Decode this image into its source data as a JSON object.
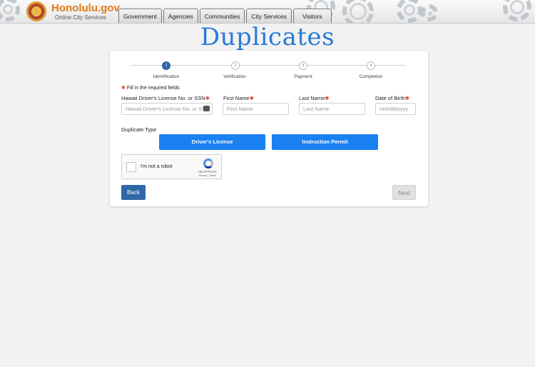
{
  "header": {
    "site_name": "Honolulu.gov",
    "site_subtitle": "Online City Services",
    "nav": [
      "Government",
      "Agencies",
      "Communities",
      "City Services",
      "Visitors"
    ]
  },
  "page_title": "Duplicates",
  "steps": [
    {
      "num": "1",
      "label": "Identification",
      "active": true
    },
    {
      "num": "2",
      "label": "Verification",
      "active": false
    },
    {
      "num": "3",
      "label": "Payment",
      "active": false
    },
    {
      "num": "4",
      "label": "Completion",
      "active": false
    }
  ],
  "form": {
    "required_note": "Fill in the required fields",
    "license": {
      "label": "Hawaii Driver's License No. or SSN",
      "placeholder": "Hawaii Driver's License No. or SSN"
    },
    "first_name": {
      "label": "First Name",
      "placeholder": "First Name"
    },
    "last_name": {
      "label": "Last Name",
      "placeholder": "Last Name"
    },
    "dob": {
      "label": "Date of Birth",
      "placeholder": "mm/dd/yyyy"
    },
    "duplicate_type_label": "Duplicate Type",
    "drivers_license_button": "Driver's License",
    "instruction_permit_button": "Instruction Permit"
  },
  "captcha": {
    "label": "I'm not a robot",
    "brand": "reCAPTCHA",
    "links": "Privacy - Terms"
  },
  "buttons": {
    "back": "Back",
    "next": "Next"
  },
  "colors": {
    "accent": "#1a81f0",
    "primary": "#2f67a8",
    "title": "#2a7ad8",
    "required": "#e43a2d",
    "brand_orange": "#e07a1a"
  }
}
